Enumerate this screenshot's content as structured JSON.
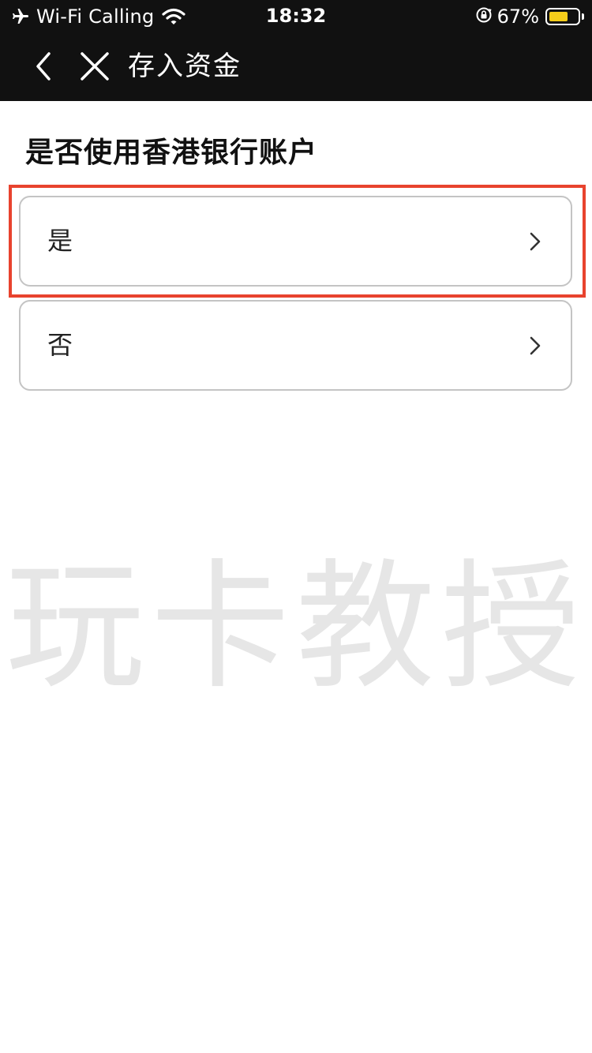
{
  "status_bar": {
    "carrier": "Wi-Fi Calling",
    "time": "18:32",
    "battery_percent": "67%",
    "battery_level": 0.67,
    "battery_color": "#f5cc1a",
    "icons": [
      "airplane-icon",
      "wifi-icon",
      "orientation-lock-icon",
      "battery-icon"
    ]
  },
  "navbar": {
    "title": "存入资金",
    "icons": [
      "back-arrow-icon",
      "close-icon"
    ]
  },
  "section": {
    "title": "是否使用香港银行账户"
  },
  "options": [
    {
      "label": "是",
      "highlighted": true,
      "icon": "chevron-right-icon"
    },
    {
      "label": "否",
      "highlighted": false,
      "icon": "chevron-right-icon"
    }
  ],
  "watermark": "玩卡教授",
  "colors": {
    "header_bg": "#111111",
    "highlight_border": "#e8432e",
    "option_border": "#c4c4c4"
  }
}
